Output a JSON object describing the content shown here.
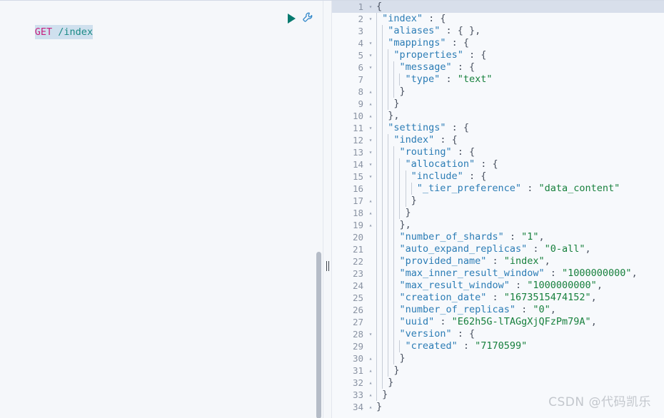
{
  "request_editor": {
    "method": "GET",
    "path": " /index",
    "run_label": "play-icon",
    "wrench_label": "wrench-icon"
  },
  "response_viewer": {
    "active_line": 1,
    "lines": [
      {
        "n": 1,
        "fold": "down",
        "indent": 0,
        "text": "{"
      },
      {
        "n": 2,
        "fold": "down",
        "indent": 1,
        "text": "\"index\" : {",
        "key": "\"index\""
      },
      {
        "n": 3,
        "fold": "",
        "indent": 2,
        "text": "\"aliases\" : { },"
      },
      {
        "n": 4,
        "fold": "down",
        "indent": 2,
        "text": "\"mappings\" : {"
      },
      {
        "n": 5,
        "fold": "down",
        "indent": 3,
        "text": "\"properties\" : {"
      },
      {
        "n": 6,
        "fold": "down",
        "indent": 4,
        "text": "\"message\" : {"
      },
      {
        "n": 7,
        "fold": "",
        "indent": 5,
        "text": "\"type\" : \"text\""
      },
      {
        "n": 8,
        "fold": "up",
        "indent": 4,
        "text": "}"
      },
      {
        "n": 9,
        "fold": "up",
        "indent": 3,
        "text": "}"
      },
      {
        "n": 10,
        "fold": "up",
        "indent": 2,
        "text": "},"
      },
      {
        "n": 11,
        "fold": "down",
        "indent": 2,
        "text": "\"settings\" : {"
      },
      {
        "n": 12,
        "fold": "down",
        "indent": 3,
        "text": "\"index\" : {"
      },
      {
        "n": 13,
        "fold": "down",
        "indent": 4,
        "text": "\"routing\" : {"
      },
      {
        "n": 14,
        "fold": "down",
        "indent": 5,
        "text": "\"allocation\" : {"
      },
      {
        "n": 15,
        "fold": "down",
        "indent": 6,
        "text": "\"include\" : {"
      },
      {
        "n": 16,
        "fold": "",
        "indent": 7,
        "text": "\"_tier_preference\" : \"data_content\""
      },
      {
        "n": 17,
        "fold": "up",
        "indent": 6,
        "text": "}"
      },
      {
        "n": 18,
        "fold": "up",
        "indent": 5,
        "text": "}"
      },
      {
        "n": 19,
        "fold": "up",
        "indent": 4,
        "text": "},"
      },
      {
        "n": 20,
        "fold": "",
        "indent": 4,
        "text": "\"number_of_shards\" : \"1\","
      },
      {
        "n": 21,
        "fold": "",
        "indent": 4,
        "text": "\"auto_expand_replicas\" : \"0-all\","
      },
      {
        "n": 22,
        "fold": "",
        "indent": 4,
        "text": "\"provided_name\" : \"index\","
      },
      {
        "n": 23,
        "fold": "",
        "indent": 4,
        "text": "\"max_inner_result_window\" : \"1000000000\","
      },
      {
        "n": 24,
        "fold": "",
        "indent": 4,
        "text": "\"max_result_window\" : \"1000000000\","
      },
      {
        "n": 25,
        "fold": "",
        "indent": 4,
        "text": "\"creation_date\" : \"1673515474152\","
      },
      {
        "n": 26,
        "fold": "",
        "indent": 4,
        "text": "\"number_of_replicas\" : \"0\","
      },
      {
        "n": 27,
        "fold": "",
        "indent": 4,
        "text": "\"uuid\" : \"E62h5G-lTAGgXjQFzPm79A\","
      },
      {
        "n": 28,
        "fold": "down",
        "indent": 4,
        "text": "\"version\" : {"
      },
      {
        "n": 29,
        "fold": "",
        "indent": 5,
        "text": "\"created\" : \"7170599\""
      },
      {
        "n": 30,
        "fold": "up",
        "indent": 4,
        "text": "}"
      },
      {
        "n": 31,
        "fold": "up",
        "indent": 3,
        "text": "}"
      },
      {
        "n": 32,
        "fold": "up",
        "indent": 2,
        "text": "}"
      },
      {
        "n": 33,
        "fold": "up",
        "indent": 1,
        "text": "}"
      },
      {
        "n": 34,
        "fold": "up",
        "indent": 0,
        "text": "}"
      }
    ]
  },
  "watermark": {
    "text": "CSDN @代码凯乐"
  },
  "colors": {
    "key": "#2b7cb5",
    "string": "#17803d",
    "method": "#c7217f",
    "url": "#1a8a86",
    "run": "#067a6f",
    "active_line": "#d8dfeb"
  }
}
